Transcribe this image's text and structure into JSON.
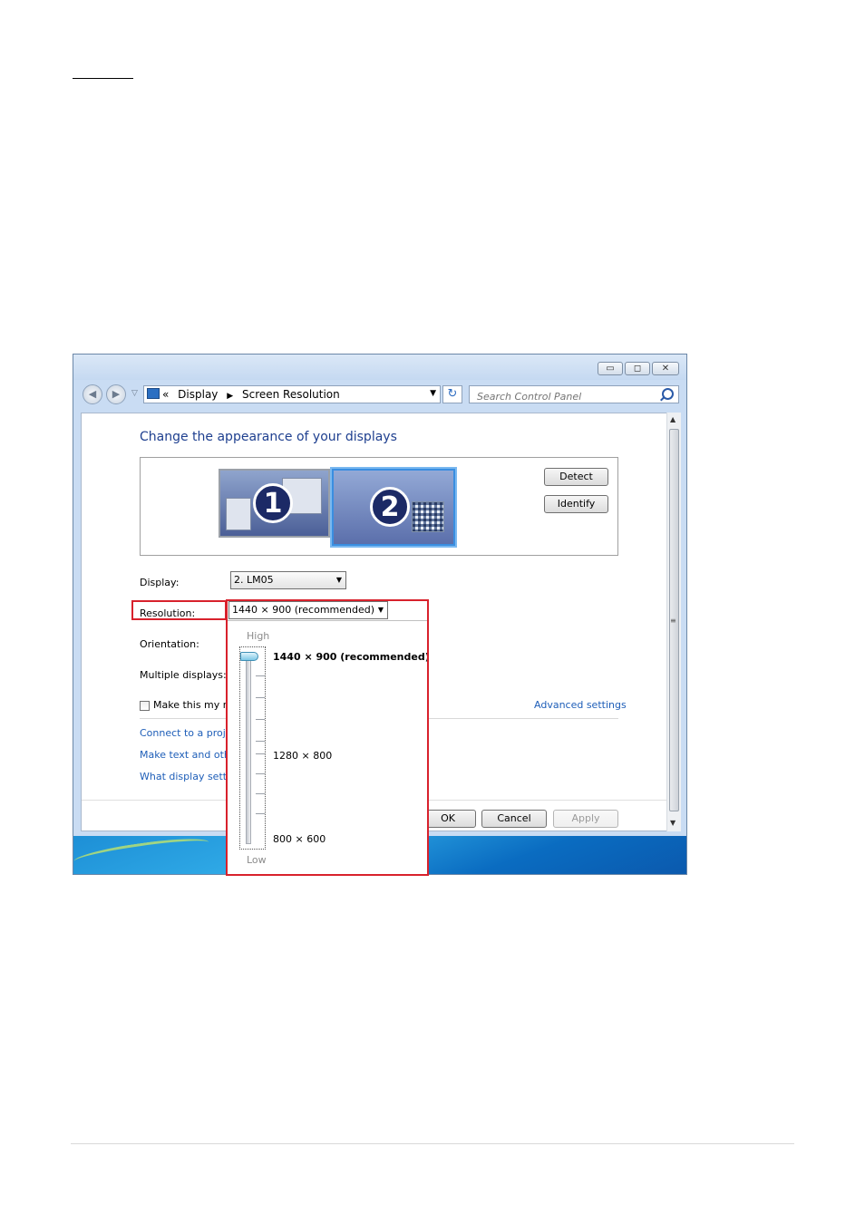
{
  "window": {
    "controls": {
      "minimize": "▭",
      "maximize": "◻",
      "close": "✕"
    }
  },
  "address_bar": {
    "prefix": "«",
    "crumbs": [
      "Display",
      "Screen Resolution"
    ],
    "separator": "▶"
  },
  "search": {
    "placeholder": "Search Control Panel"
  },
  "main": {
    "heading": "Change the appearance of your displays",
    "monitors": [
      {
        "number": "1",
        "selected": false
      },
      {
        "number": "2",
        "selected": true
      }
    ],
    "detect_label": "Detect",
    "identify_label": "Identify",
    "display_label": "Display:",
    "display_value": "2. LM05",
    "resolution_label": "Resolution:",
    "resolution_value": "1440 × 900 (recommended)",
    "orientation_label": "Orientation:",
    "multiple_displays_label": "Multiple displays:",
    "make_main_label": "Make this my m",
    "advanced_settings": "Advanced settings",
    "link_projector": "Connect to a projec",
    "link_text_size": "Make text and othe",
    "link_what_settings": "What display settin"
  },
  "footer": {
    "ok_label": "OK",
    "cancel_label": "Cancel",
    "apply_label": "Apply"
  },
  "resolution_popup": {
    "high_label": "High",
    "low_label": "Low",
    "options": [
      "1440 × 900 (recommended)",
      "1280 × 800",
      "800 × 600"
    ],
    "selected_option": "1440 × 900 (recommended)",
    "slider_level_fraction": 1.0
  },
  "colors": {
    "highlight": "#d8212c",
    "heading": "#1e3f8f",
    "link": "#1e5eb8"
  }
}
